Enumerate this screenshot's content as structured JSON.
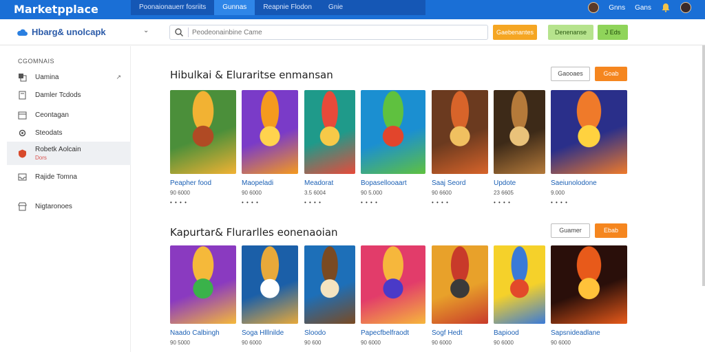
{
  "app": {
    "brand": "Marketpplace"
  },
  "topnav": {
    "tabs": [
      {
        "label": "Poonaionauerr fosriits"
      },
      {
        "label": "Gunnas"
      },
      {
        "label": "Reapnie Flodon"
      },
      {
        "label": "Gnie"
      }
    ]
  },
  "topright": {
    "link1": "Gnns",
    "link2": "Gans"
  },
  "subbar": {
    "logo_text": "Hbarg& unolcapk",
    "search_placeholder": "Peodeonainbine Came",
    "orange_btn": "Gaebenantes",
    "green_btn": "Denenanse",
    "green_btn2": "J Eds"
  },
  "sidebar": {
    "title": "CGOMNAIS",
    "items": [
      {
        "label": "Uamina",
        "icon": "layers-icon"
      },
      {
        "label": "Damler Tcdods",
        "icon": "book-icon"
      },
      {
        "label": "Ceontagan",
        "icon": "calendar-icon"
      },
      {
        "label": "Steodats",
        "icon": "settings-icon"
      },
      {
        "label": "Robetk Aolcain",
        "sub": "Dors",
        "icon": "shield-icon"
      },
      {
        "label": "Rajide Tomna",
        "icon": "inbox-icon"
      },
      {
        "label": "Nigtaronoes",
        "icon": "store-icon"
      }
    ]
  },
  "sections": [
    {
      "title": "Hibulkai & Eluraritse enmansan",
      "btn_white": "Gaooaes",
      "btn_orange": "Goab",
      "cards": [
        {
          "name": "Peapher food",
          "meta": "90 6000",
          "dots": "• • • •",
          "art": "jungle-hero"
        },
        {
          "name": "Maopeladi",
          "meta": "90 6000",
          "dots": "• • • •",
          "art": "orange-critter"
        },
        {
          "name": "Meadorat",
          "meta": "3.5 6004",
          "dots": "• • • •",
          "art": "pirate-hero"
        },
        {
          "name": "Bopasellooaart",
          "meta": "90 5.000",
          "dots": "• • • •",
          "art": "kart-racer"
        },
        {
          "name": "Saaj Seord",
          "meta": "90 6600",
          "dots": "• • • •",
          "art": "cannon-warrior"
        },
        {
          "name": "Updote",
          "meta": "23 6605",
          "dots": "• • • •",
          "art": "desert-warrior"
        },
        {
          "name": "Saeiunolodone",
          "meta": "9.000",
          "dots": "• • • •",
          "art": "party-crew"
        }
      ]
    },
    {
      "title": "Kapurtar& Flurarlles eonenaoian",
      "btn_white": "Guamer",
      "btn_orange": "Ebab",
      "cards": [
        {
          "name": "Naado Calbingh",
          "meta": "90 5000",
          "dots": "",
          "art": "bubble-puzzle"
        },
        {
          "name": "Soga Hlllnilde",
          "meta": "90 6000",
          "dots": "",
          "art": "guitar-hero"
        },
        {
          "name": "Sloodo",
          "meta": "90 600",
          "dots": "",
          "art": "animal-board"
        },
        {
          "name": "Papecfbelfraodt",
          "meta": "90 6000",
          "dots": "",
          "art": "match-three"
        },
        {
          "name": "Sogf Hedt",
          "meta": "90 6000",
          "dots": "",
          "art": "knight-fighter"
        },
        {
          "name": "Bapiood",
          "meta": "90 6000",
          "dots": "",
          "art": "kids-adventure"
        },
        {
          "name": "Sapsnideadlane",
          "meta": "90 6000",
          "dots": "",
          "art": "fire-arena"
        }
      ]
    }
  ],
  "colors": {
    "top_blue": "#1a6fd6",
    "accent_orange": "#f5861f",
    "link_blue": "#1a5fb4",
    "green": "#b6e38d"
  }
}
